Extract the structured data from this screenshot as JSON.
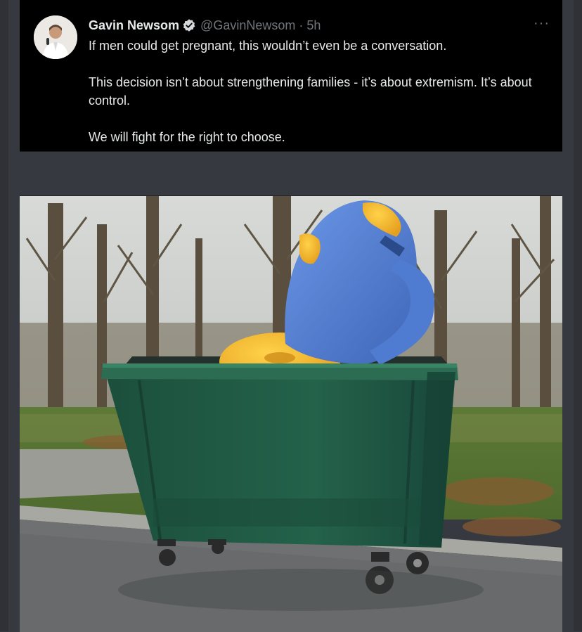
{
  "tweet": {
    "author_name": "Gavin Newsom",
    "handle": "@GavinNewsom",
    "separator": "·",
    "time": "5h",
    "more_label": "···",
    "paragraphs": [
      "If men could get pregnant, this wouldn’t even be a conversation.",
      "This decision isn’t about strengthening families - it’s about extremism. It’s about control.",
      "We will fight for the right to choose."
    ],
    "icons": {
      "verified": "verified-badge-icon",
      "more": "more-options-icon"
    }
  },
  "colors": {
    "page_bg": "#36393f",
    "tweet_bg": "#000000",
    "text": "#e7e9ea",
    "muted": "#71767b",
    "dumpster": "#1f5a45",
    "emoji_yellow": "#f2b533",
    "emoji_blue": "#4a76c8"
  }
}
